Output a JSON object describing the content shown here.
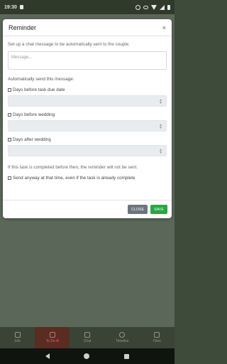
{
  "status_bar": {
    "time": "19:30"
  },
  "dialog": {
    "title": "Reminder",
    "close_glyph": "×",
    "intro": "Set up a chat message to be automatically sent to the couple.",
    "message_placeholder": "Message...",
    "auto_send_label": "Automatically send this message:",
    "options": [
      {
        "label": "Days before task due date"
      },
      {
        "label": "Days before wedding"
      },
      {
        "label": "Days after wedding"
      }
    ],
    "note": "If this task is completed before then, the reminder will not be sent.",
    "send_anyway_label": "Send anyway at that time, even if the task is already complete",
    "close_button": "CLOSE",
    "save_button": "SAVE"
  },
  "tabs": [
    {
      "label": "Info",
      "icon": "calendar-icon"
    },
    {
      "label": "To Do",
      "icon": "shield-check-icon",
      "active": true
    },
    {
      "label": "Chat",
      "icon": "chat-icon"
    },
    {
      "label": "Timeline",
      "icon": "stopwatch-icon"
    },
    {
      "label": "Files",
      "icon": "file-icon"
    }
  ],
  "colors": {
    "primary_button": "#6c757d",
    "save_button": "#28a745",
    "active_tab": "#5a2c22"
  }
}
